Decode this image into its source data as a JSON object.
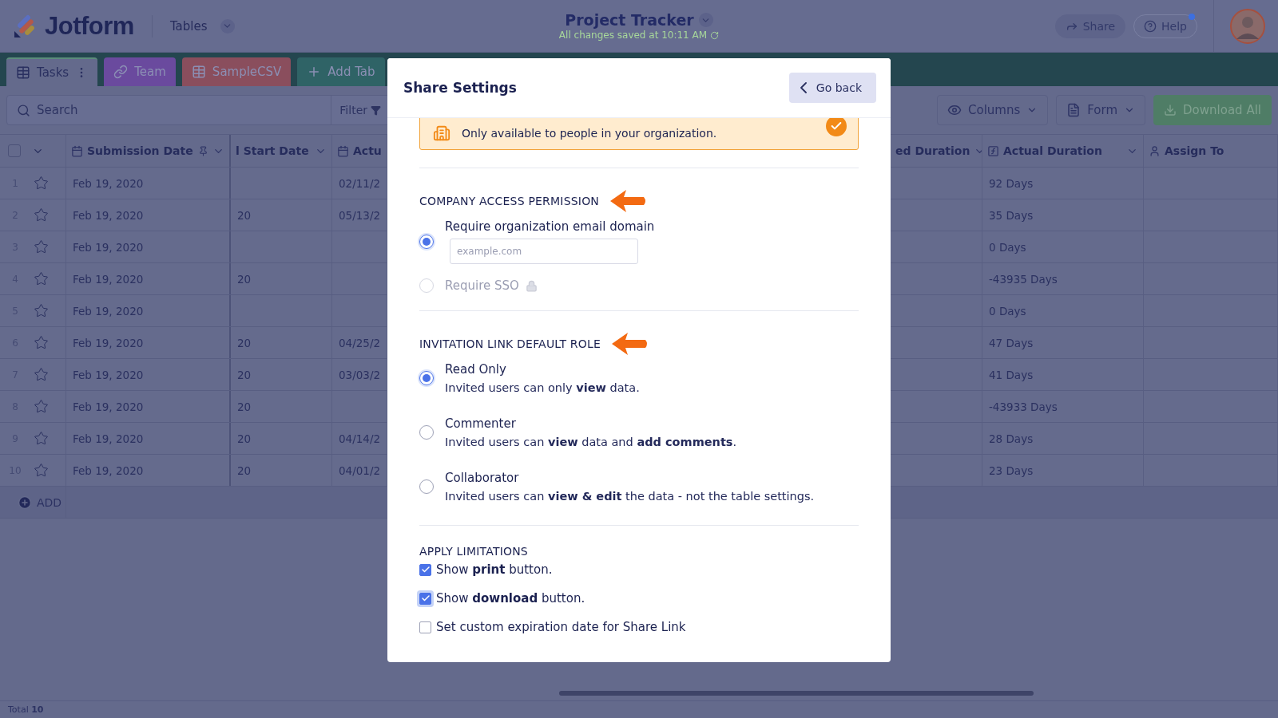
{
  "header": {
    "brand": "Jotform",
    "section": "Tables",
    "title": "Project Tracker",
    "save_status": "All changes saved at 10:11 AM",
    "share": "Share",
    "help": "Help",
    "help_notification": true
  },
  "tabs": [
    {
      "label": "Tasks",
      "selected": true,
      "color": "#5f6689",
      "kind": "grid"
    },
    {
      "label": "Team",
      "selected": false,
      "color": "#6a4a9e",
      "kind": "link"
    },
    {
      "label": "SampleCSV",
      "selected": false,
      "color": "#8a4e5d",
      "kind": "grid"
    }
  ],
  "add_tab": "Add Tab",
  "toolbar": {
    "search_placeholder": "Search",
    "filter": "Filter",
    "columns": "Columns",
    "form": "Form",
    "download": "Download All"
  },
  "table": {
    "select_all": {
      "checked": false
    },
    "columns": [
      {
        "label": "Submission Date",
        "kind": "date",
        "pinned": true
      },
      {
        "label": "l Start Date",
        "kind": "plain"
      },
      {
        "label": "Actu",
        "kind": "date"
      },
      {
        "label": "ed Duration",
        "kind": "plain"
      },
      {
        "label": "Actual Duration",
        "kind": "formula"
      },
      {
        "label": "Assign To",
        "kind": "person"
      }
    ],
    "rows": [
      {
        "number": "1",
        "starred": false,
        "date": "Feb 19, 2020",
        "actu": "02/11/2",
        "duration": "92 Days"
      },
      {
        "number": "2",
        "starred": false,
        "date": "Feb 19, 2020",
        "start": "20",
        "actu": "05/13/2",
        "duration": "35 Days"
      },
      {
        "number": "3",
        "starred": false,
        "date": "Feb 19, 2020",
        "duration": "0 Days"
      },
      {
        "number": "4",
        "starred": false,
        "date": "Feb 19, 2020",
        "start": "20",
        "duration": "-43935 Days"
      },
      {
        "number": "5",
        "starred": false,
        "date": "Feb 19, 2020",
        "duration": "0 Days"
      },
      {
        "number": "6",
        "starred": false,
        "date": "Feb 19, 2020",
        "start": "20",
        "actu": "04/25/2",
        "duration": "47 Days"
      },
      {
        "number": "7",
        "starred": false,
        "date": "Feb 19, 2020",
        "start": "20",
        "actu": "03/03/2",
        "duration": "41 Days"
      },
      {
        "number": "8",
        "starred": false,
        "date": "Feb 19, 2020",
        "start": "20",
        "duration": "-43933 Days"
      },
      {
        "number": "9",
        "starred": false,
        "date": "Feb 19, 2020",
        "start": "20",
        "actu": "04/14/2",
        "duration": "28 Days"
      },
      {
        "number": "10",
        "starred": false,
        "date": "Feb 19, 2020",
        "start": "20",
        "actu": "04/01/2",
        "duration": "23 Days"
      }
    ],
    "add_row": "ADD"
  },
  "status_bar": "Total **10**",
  "modal": {
    "title": "Share Settings",
    "back": "Go back",
    "notice": {
      "text": "Only available to people in your organization.",
      "checked": true
    },
    "sections": [
      {
        "kind": "radio",
        "heading": "COMPANY ACCESS PERMISSION",
        "annotated": true,
        "options": [
          {
            "label": "Require organization email domain",
            "selected": true,
            "disabled": false,
            "placeholder": "example.com"
          },
          {
            "label": "Require SSO",
            "selected": false,
            "disabled": true,
            "locked": true
          }
        ]
      },
      {
        "kind": "radio",
        "heading": "INVITATION LINK DEFAULT ROLE",
        "annotated": true,
        "options": [
          {
            "label": "Read Only",
            "description": "Invited users can only **view** data.",
            "selected": true,
            "disabled": false
          },
          {
            "label": "Commenter",
            "description": "Invited users can **view** data and **add comments**.",
            "selected": false,
            "disabled": false
          },
          {
            "label": "Collaborator",
            "description": "Invited users can **view & edit** the data - not the table settings.",
            "selected": false,
            "disabled": false
          }
        ]
      },
      {
        "kind": "checkbox",
        "heading": "APPLY LIMITATIONS",
        "options": [
          {
            "label": "Show **print** button.",
            "checked": true
          },
          {
            "label": "Show **download** button.",
            "checked": true,
            "focused": true
          },
          {
            "label": "Set custom expiration date for Share Link",
            "checked": false
          }
        ]
      }
    ]
  }
}
